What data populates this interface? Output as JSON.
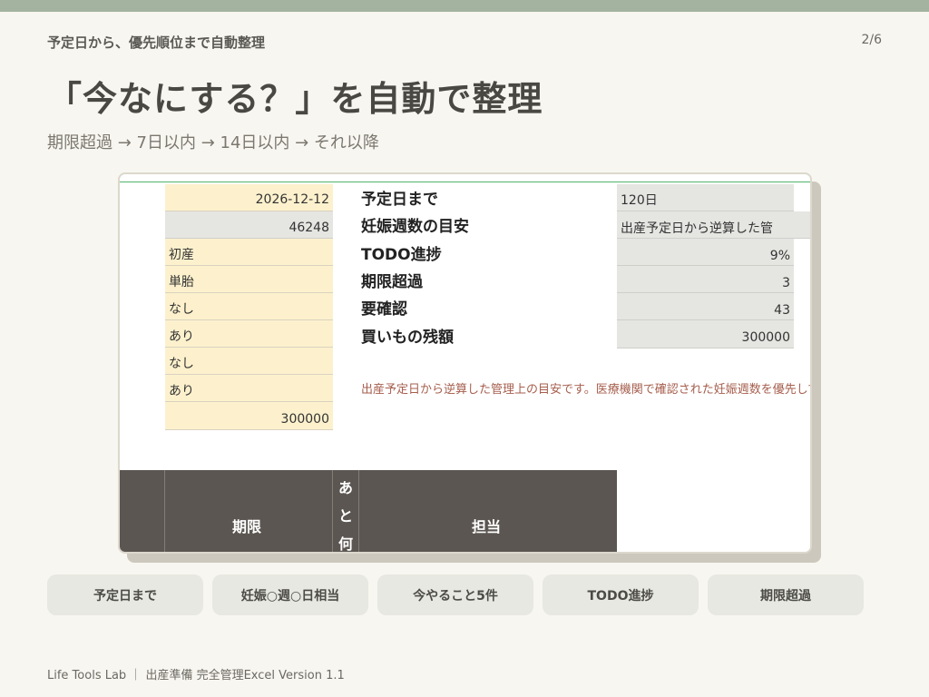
{
  "header": {
    "eyebrow": "予定日から、優先順位まで自動整理",
    "page": "2/6",
    "title": "「今なにする？」を自動で整理",
    "subtitle": "期限超過 → 7日以内 → 14日以内 → それ以降"
  },
  "sheet": {
    "input_cells": [
      "2026-12-12",
      "46248",
      "初産",
      "単胎",
      "なし",
      "あり",
      "なし",
      "あり",
      "300000"
    ],
    "labels": [
      "予定日まで",
      "妊娠週数の目安",
      "TODO進捗",
      "期限超過",
      "要確認",
      "買いもの残額"
    ],
    "metric_values": [
      "120日",
      "出産予定日から逆算した管",
      "9%",
      "3",
      "43",
      "300000"
    ],
    "note": "出産予定日から逆算した管理上の目安です。医療機関で確認された妊娠週数を優先してください。",
    "table_header": {
      "deadline": "期限",
      "days_left": "あと何",
      "owner": "担当"
    }
  },
  "pills": [
    "予定日まで",
    "妊娠○週○日相当",
    "今やること5件",
    "TODO進捗",
    "期限超過"
  ],
  "footer": "Life Tools Lab ｜ 出産準備 完全管理Excel  Version 1.1",
  "colors": {
    "background": "#f8f6f0",
    "top_bar": "#a3b3a0",
    "input_cell": "#fdf1cd",
    "metric_cell": "#e5e5e2",
    "header_band": "#5b5651",
    "note_text": "#a65e4d",
    "pill": "#e6e8e1"
  }
}
